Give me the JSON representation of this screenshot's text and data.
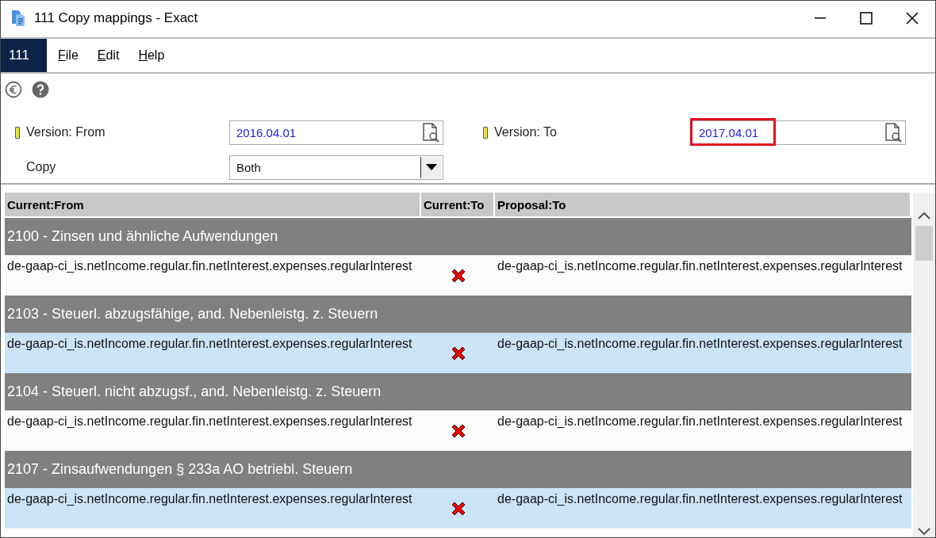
{
  "window": {
    "title": "111 Copy mappings - Exact"
  },
  "menu_bar": {
    "company": "111",
    "items": [
      "File",
      "Edit",
      "Help"
    ]
  },
  "form": {
    "fields": [
      {
        "kind": "lookup",
        "label": "Version: From",
        "required": true,
        "value": "2016.04.01",
        "highlighted": false
      },
      {
        "kind": "lookup",
        "label": "Version: To",
        "required": true,
        "value": "2017.04.01",
        "highlighted": true
      },
      {
        "kind": "dropdown",
        "label": "Copy",
        "required": false,
        "value": "Both",
        "highlighted": false
      }
    ]
  },
  "table": {
    "columns": [
      "Current:From",
      "Current:To",
      "Proposal:To"
    ],
    "rows": [
      {
        "kind": "group",
        "title": "2100 - Zinsen und ähnliche Aufwendungen"
      },
      {
        "kind": "mapping",
        "current_from": "de-gaap-ci_is.netIncome.regular.fin.netInterest.expenses.regularInterest",
        "current_to_missing": true,
        "proposal_to": "de-gaap-ci_is.netIncome.regular.fin.netInterest.expenses.regularInterest"
      },
      {
        "kind": "group",
        "title": "2103 - Steuerl. abzugsfähige, and. Nebenleistg. z. Steuern"
      },
      {
        "kind": "mapping",
        "current_from": "de-gaap-ci_is.netIncome.regular.fin.netInterest.expenses.regularInterest",
        "current_to_missing": true,
        "proposal_to": "de-gaap-ci_is.netIncome.regular.fin.netInterest.expenses.regularInterest"
      },
      {
        "kind": "group",
        "title": "2104 - Steuerl. nicht abzugsf., and. Nebenleistg. z. Steuern"
      },
      {
        "kind": "mapping",
        "current_from": "de-gaap-ci_is.netIncome.regular.fin.netInterest.expenses.regularInterest",
        "current_to_missing": true,
        "proposal_to": "de-gaap-ci_is.netIncome.regular.fin.netInterest.expenses.regularInterest"
      },
      {
        "kind": "group",
        "title": "2107 - Zinsaufwendungen § 233a AO betriebl. Steuern"
      },
      {
        "kind": "mapping",
        "current_from": "de-gaap-ci_is.netIncome.regular.fin.netInterest.expenses.regularInterest",
        "current_to_missing": true,
        "proposal_to": "de-gaap-ci_is.netIncome.regular.fin.netInterest.expenses.regularInterest"
      }
    ]
  }
}
